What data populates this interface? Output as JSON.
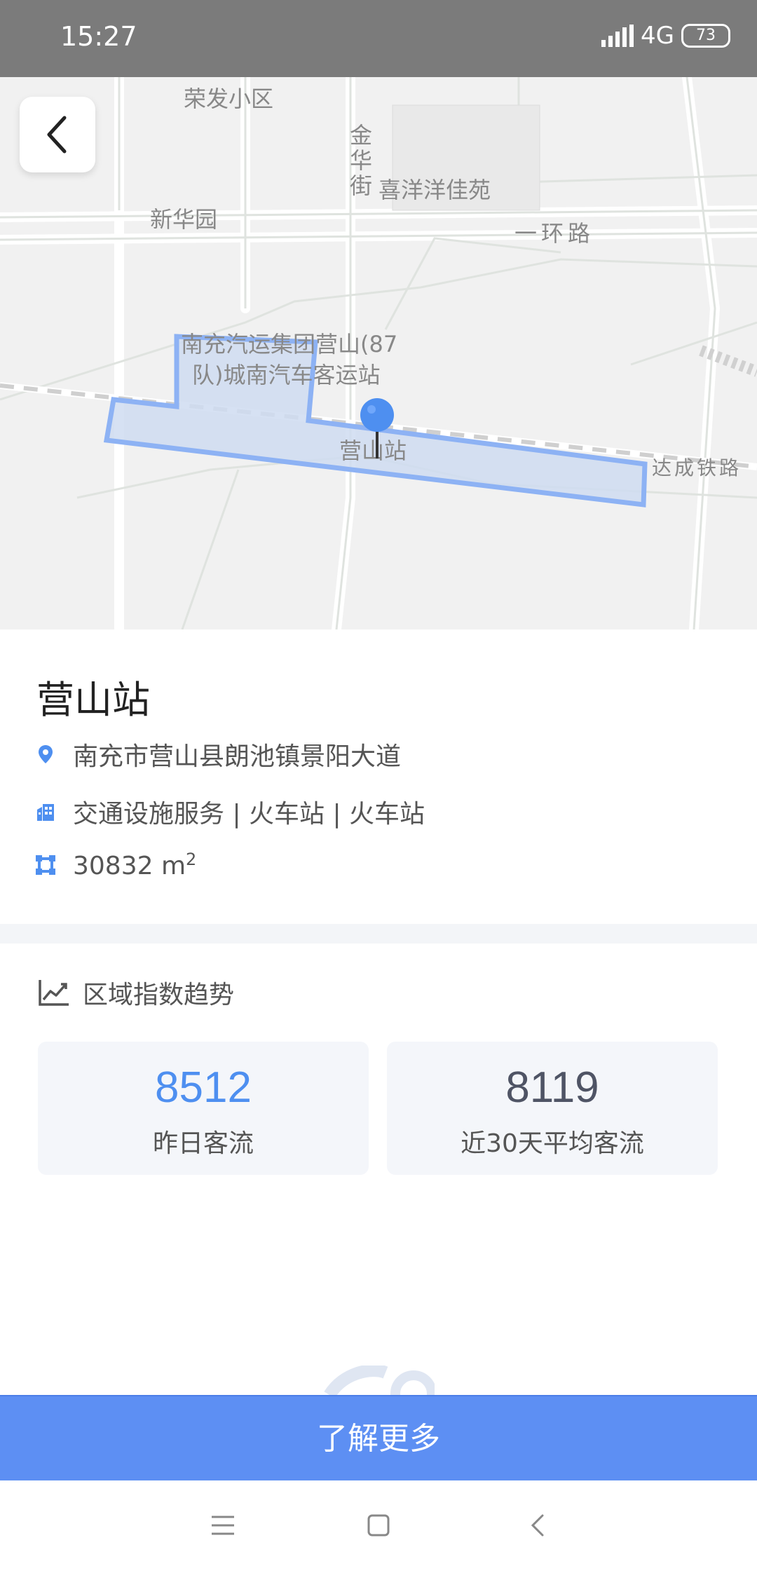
{
  "status_bar": {
    "time": "15:27",
    "network": "4G",
    "battery": "73"
  },
  "map": {
    "labels": [
      {
        "id": "rongfa",
        "text": "荣发小区"
      },
      {
        "id": "jinhua",
        "text": "金华街"
      },
      {
        "id": "xiyang",
        "text": "喜洋洋佳苑"
      },
      {
        "id": "xinhua",
        "text": "新华园"
      },
      {
        "id": "yihuan",
        "text": "一环路"
      },
      {
        "id": "bus1",
        "text": "南充汽运集团营山(87"
      },
      {
        "id": "bus2",
        "text": "队)城南汽车客运站"
      },
      {
        "id": "station",
        "text": "营山站"
      },
      {
        "id": "dacheng",
        "text": "达成铁路"
      }
    ],
    "accent": "#4e8ff0"
  },
  "place": {
    "name": "营山站",
    "address": "南充市营山县朗池镇景阳大道",
    "category": "交通设施服务 | 火车站 | 火车站",
    "area_value": "30832 m",
    "area_sup": "2"
  },
  "trend": {
    "title": "区域指数趋势",
    "stats": [
      {
        "value": "8512",
        "label": "昨日客流"
      },
      {
        "value": "8119",
        "label": "近30天平均客流"
      }
    ]
  },
  "cta": {
    "label": "了解更多"
  },
  "colors": {
    "primary": "#5d8ff3",
    "stat_primary": "#4e8ff0",
    "stat_secondary": "#4f5465"
  }
}
